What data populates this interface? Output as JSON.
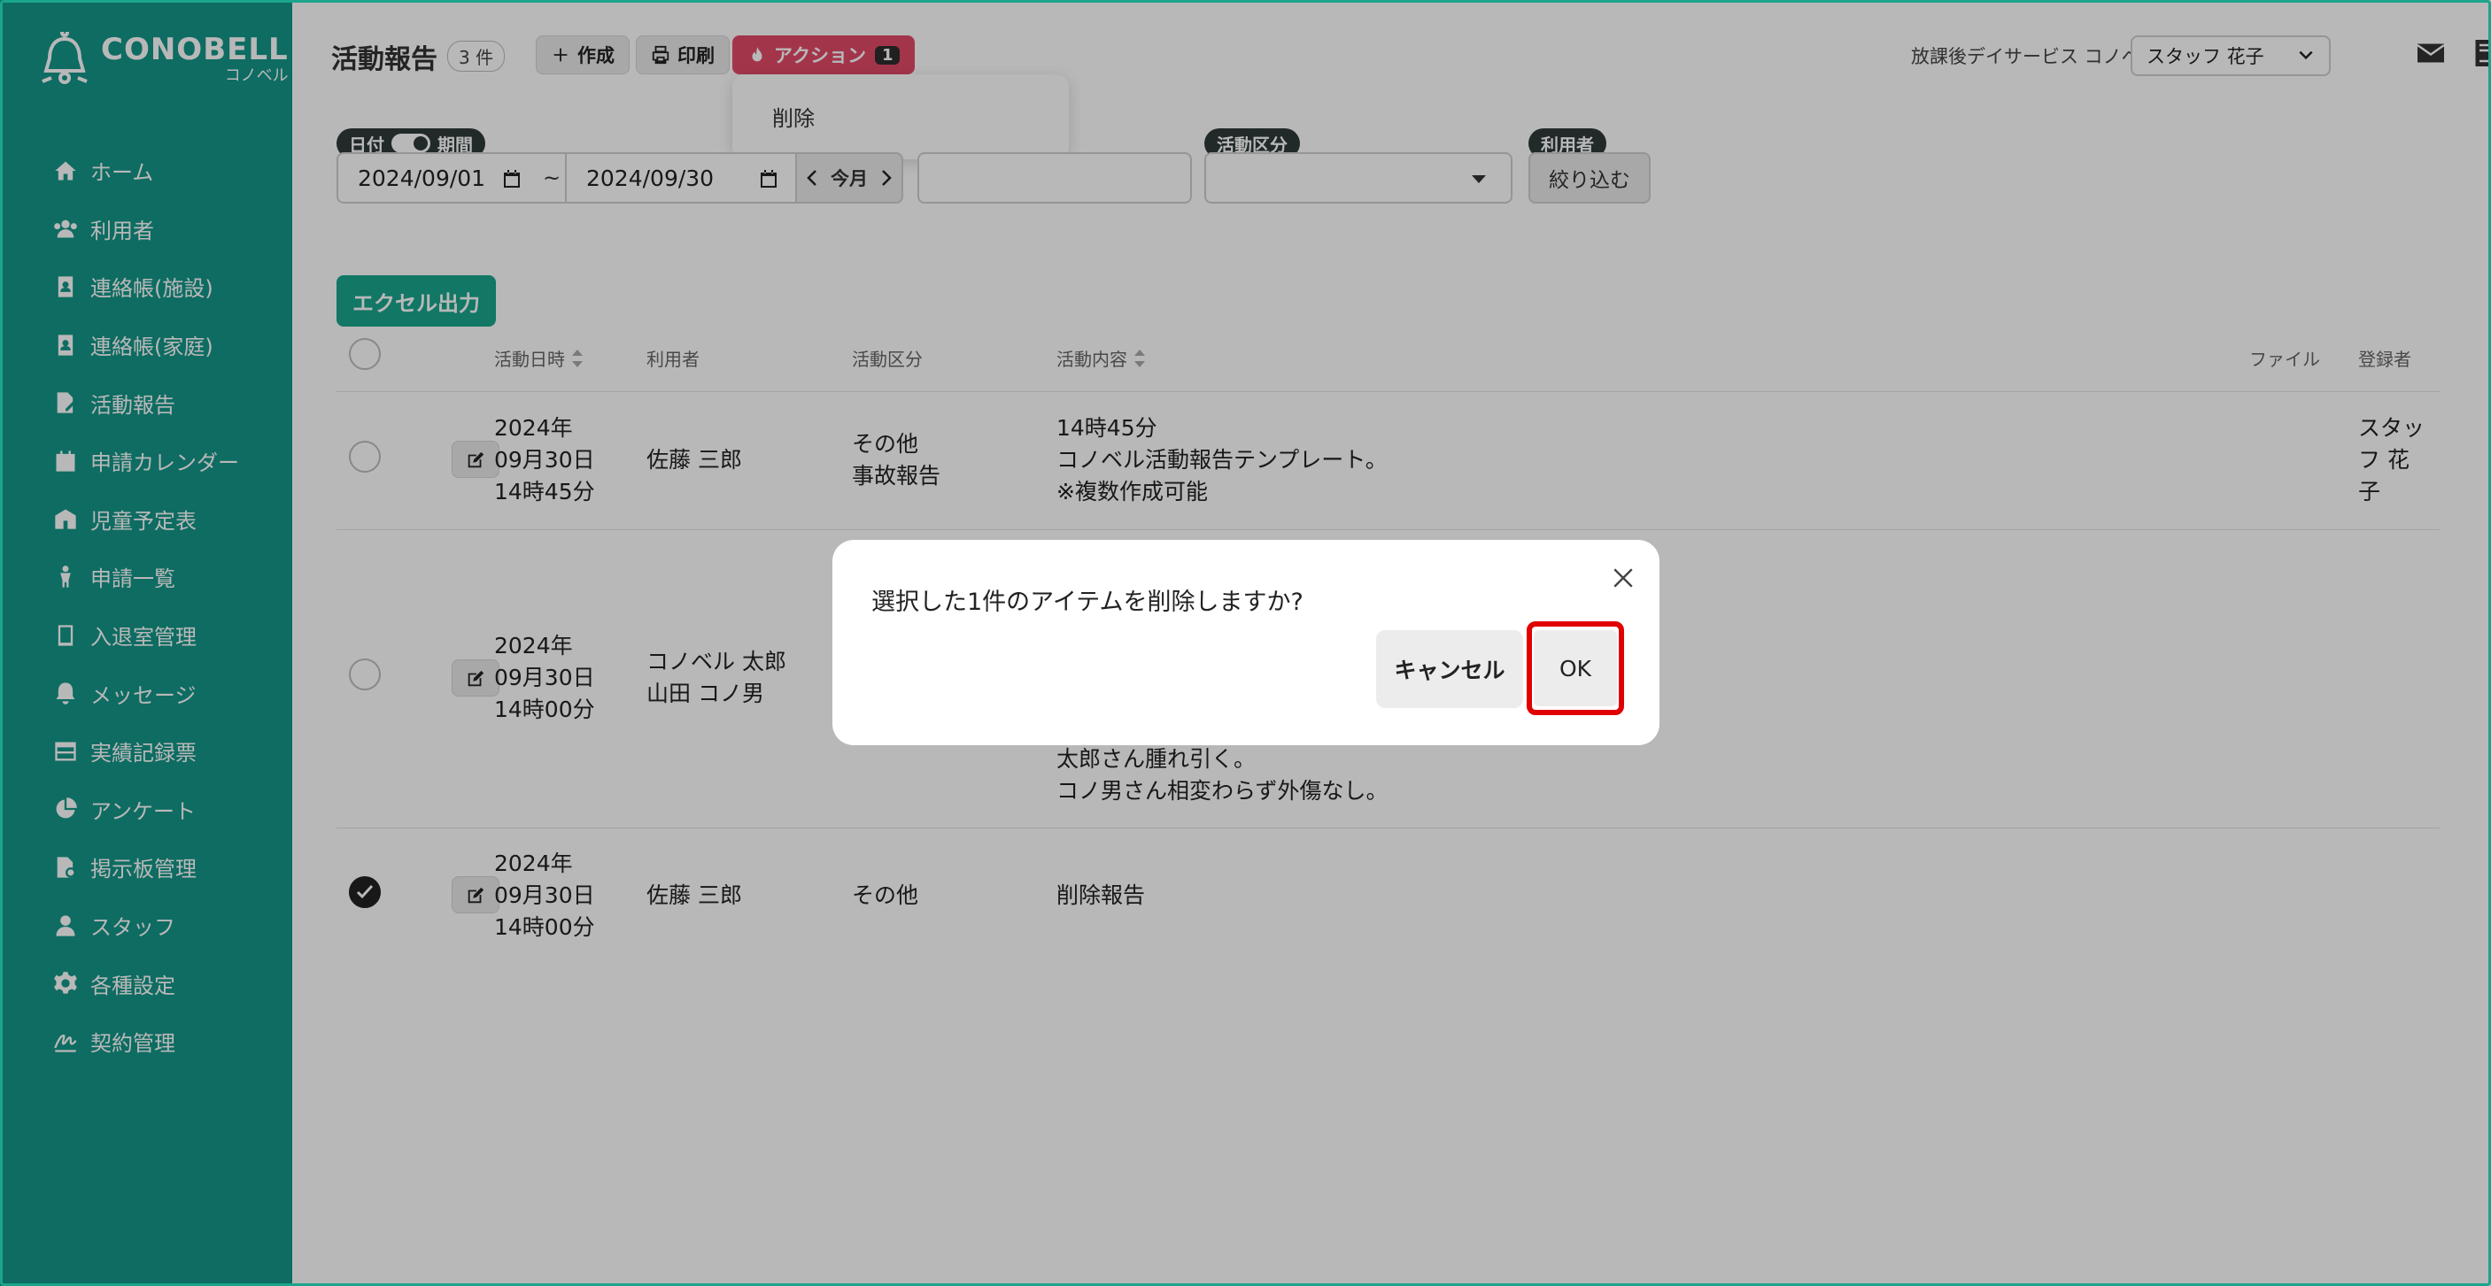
{
  "brand": {
    "name": "CONOBELL",
    "sub": "コノベル"
  },
  "sidebar": {
    "items": [
      {
        "label": "ホーム"
      },
      {
        "label": "利用者"
      },
      {
        "label": "連絡帳(施設)"
      },
      {
        "label": "連絡帳(家庭)"
      },
      {
        "label": "活動報告"
      },
      {
        "label": "申請カレンダー"
      },
      {
        "label": "児童予定表"
      },
      {
        "label": "申請一覧"
      },
      {
        "label": "入退室管理"
      },
      {
        "label": "メッセージ"
      },
      {
        "label": "実績記録票"
      },
      {
        "label": "アンケート"
      },
      {
        "label": "掲示板管理"
      },
      {
        "label": "スタッフ"
      },
      {
        "label": "各種設定"
      },
      {
        "label": "契約管理"
      }
    ]
  },
  "header": {
    "title": "活動報告",
    "count": "3 件",
    "create_label": "作成",
    "print_label": "印刷",
    "action_label": "アクション",
    "action_count": "1",
    "dropdown_delete": "削除",
    "facility": "放課後デイサービス コノベル",
    "staff": "スタッフ 花子"
  },
  "filters": {
    "chip_date": "日付",
    "chip_period": "期間",
    "date_from": "2024/09/01",
    "date_to": "2024/09/30",
    "tilde": "~",
    "this_month": "今月",
    "chip_category": "活動区分",
    "chip_user": "利用者",
    "narrow": "絞り込む"
  },
  "excel_label": "エクセル出力",
  "table": {
    "headers": {
      "datetime": "活動日時",
      "user": "利用者",
      "category": "活動区分",
      "content": "活動内容",
      "file": "ファイル",
      "registrant": "登録者"
    },
    "rows": [
      {
        "date": "2024年\n09月30日\n14時45分",
        "user": "佐藤 三郎",
        "category": "その他\n事故報告",
        "content": "14時45分\nコノベル活動報告テンプレート。\n※複数作成可能",
        "registrant": "スタッ\nフ 花\n子",
        "checked": false
      },
      {
        "date": "2024年\n09月30日\n14時00分",
        "user": "コノベル 太郎\n山田 コノ男",
        "category": "",
        "content": "太郎さん腫れ引く。\nコノ男さん相変わらず外傷なし。",
        "registrant": "",
        "checked": false
      },
      {
        "date": "2024年\n09月30日\n14時00分",
        "user": "佐藤 三郎",
        "category": "その他",
        "content": "削除報告",
        "registrant": "",
        "checked": true
      }
    ]
  },
  "modal": {
    "message": "選択した1件のアイテムを削除しますか?",
    "cancel": "キャンセル",
    "ok": "OK"
  },
  "colors": {
    "sidebar": "#149688",
    "accent": "#1aa58c",
    "action": "#e24a68",
    "highlight": "#e10000"
  }
}
